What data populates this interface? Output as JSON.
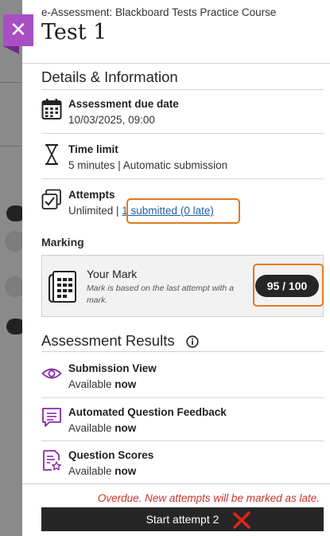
{
  "close": {
    "glyph": "✕"
  },
  "header": {
    "course": "e-Assessment: Blackboard Tests Practice Course",
    "title": "Test 1"
  },
  "details": {
    "section_title": "Details & Information",
    "due": {
      "label": "Assessment due date",
      "value": "10/03/2025, 09:00",
      "icon": "calendar-icon"
    },
    "time_limit": {
      "label": "Time limit",
      "value": "5 minutes | Automatic submission",
      "icon": "hourglass-icon"
    },
    "attempts": {
      "label": "Attempts",
      "value_prefix": "Unlimited | ",
      "link": "1 submitted (0 late)",
      "icon": "attempts-icon"
    }
  },
  "marking": {
    "label": "Marking",
    "your_mark_label": "Your Mark",
    "note": "Mark is based on the last attempt with a mark.",
    "score": "95 / 100",
    "icon": "gradebook-icon"
  },
  "results": {
    "section_title": "Assessment Results",
    "items": [
      {
        "label": "Submission View",
        "value_prefix": "Available ",
        "value_bold": "now",
        "icon": "eye-icon"
      },
      {
        "label": "Automated Question Feedback",
        "value_prefix": "Available ",
        "value_bold": "now",
        "icon": "feedback-icon"
      },
      {
        "label": "Question Scores",
        "value_prefix": "Available ",
        "value_bold": "now",
        "icon": "question-scores-icon"
      }
    ]
  },
  "footer": {
    "overdue_text": "Overdue. New attempts will be marked as late.",
    "start_label": "Start attempt 2"
  },
  "colors": {
    "accent_purple": "#a94fc4",
    "highlight_orange": "#e07b1e",
    "overdue_red": "#c8332c",
    "link_blue": "#1d5fa6"
  }
}
